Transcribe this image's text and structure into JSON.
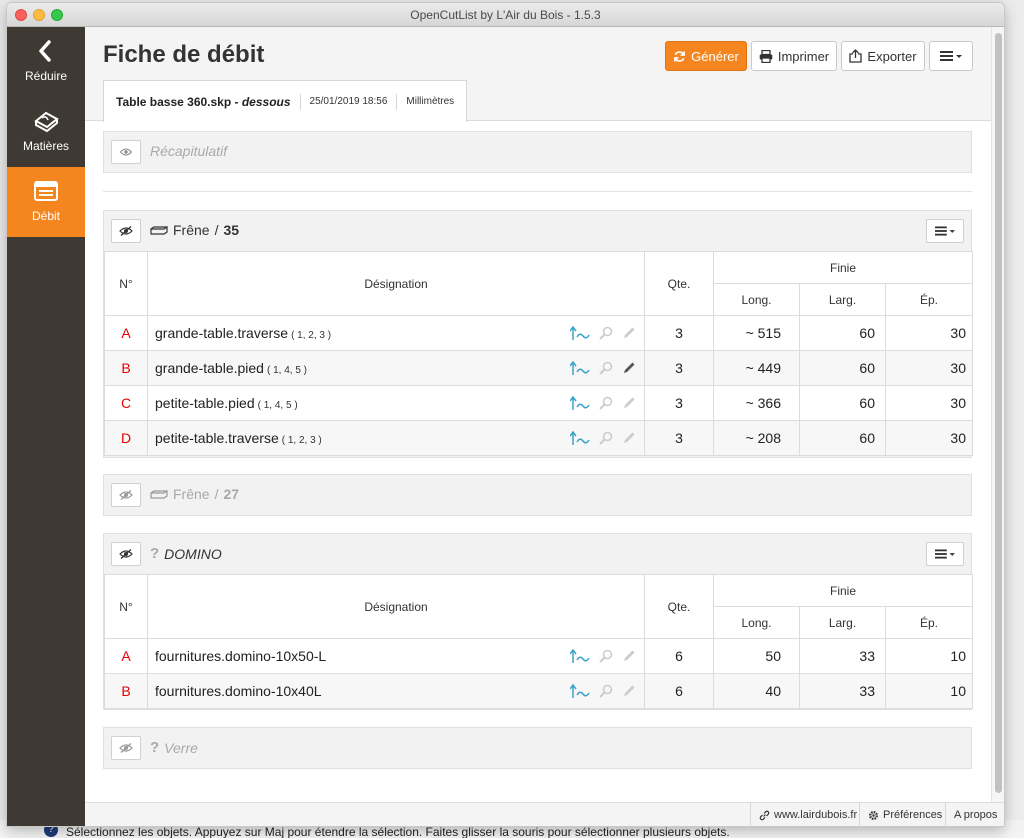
{
  "window": {
    "title": "OpenCutList by L'Air du Bois - 1.5.3"
  },
  "sidebar": {
    "items": [
      {
        "label": "Réduire",
        "icon": "chevron-left-icon"
      },
      {
        "label": "Matières",
        "icon": "materials-icon"
      },
      {
        "label": "Débit",
        "icon": "cutlist-icon",
        "active": true
      }
    ]
  },
  "header": {
    "title": "Fiche de débit",
    "buttons": {
      "generate": "Générer",
      "print": "Imprimer",
      "export": "Exporter"
    }
  },
  "tab": {
    "file": "Table basse 360.skp - ",
    "view": "dessous",
    "date": "25/01/2019 18:56",
    "unit": "Millimètres"
  },
  "summary": {
    "label": "Récapitulatif"
  },
  "columns": {
    "n": "N°",
    "designation": "Désignation",
    "qty": "Qte.",
    "finish": "Finie",
    "length": "Long.",
    "width": "Larg.",
    "thickness": "Ép."
  },
  "groups": [
    {
      "material": "Frêne",
      "thickness": "35",
      "rows": [
        {
          "letter": "A",
          "name": "grande-table.traverse",
          "numbers": "( 1, 2, 3 )",
          "qty": "3",
          "length": "~ 515",
          "width": "60",
          "thickness": "30"
        },
        {
          "letter": "B",
          "name": "grande-table.pied",
          "numbers": "( 1, 4, 5 )",
          "qty": "3",
          "length": "~ 449",
          "width": "60",
          "thickness": "30"
        },
        {
          "letter": "C",
          "name": "petite-table.pied",
          "numbers": "( 1, 4, 5 )",
          "qty": "3",
          "length": "~ 366",
          "width": "60",
          "thickness": "30"
        },
        {
          "letter": "D",
          "name": "petite-table.traverse",
          "numbers": "( 1, 2, 3 )",
          "qty": "3",
          "length": "~ 208",
          "width": "60",
          "thickness": "30"
        }
      ]
    },
    {
      "material": "Frêne",
      "thickness": "27",
      "collapsed": true
    },
    {
      "material": "DOMINO",
      "rows": [
        {
          "letter": "A",
          "name": "fournitures.domino-10x50-L",
          "qty": "6",
          "length": "50",
          "width": "33",
          "thickness": "10"
        },
        {
          "letter": "B",
          "name": "fournitures.domino-10x40L",
          "qty": "6",
          "length": "40",
          "width": "33",
          "thickness": "10"
        }
      ]
    },
    {
      "material": "Verre",
      "collapsed": true
    }
  ],
  "separator": "/",
  "unknown_mark": "?",
  "footer": {
    "link": "www.lairdubois.fr",
    "prefs": "Préférences",
    "about": "A propos"
  },
  "status_bar": "Sélectionnez les objets. Appuyez sur Maj pour étendre la sélection. Faites glisser la souris pour sélectionner plusieurs objets.",
  "colors": {
    "accent": "#f5861f",
    "sidebar": "#3e3a33",
    "letters": "#e60000",
    "teal_icon": "#3ba3c9"
  }
}
